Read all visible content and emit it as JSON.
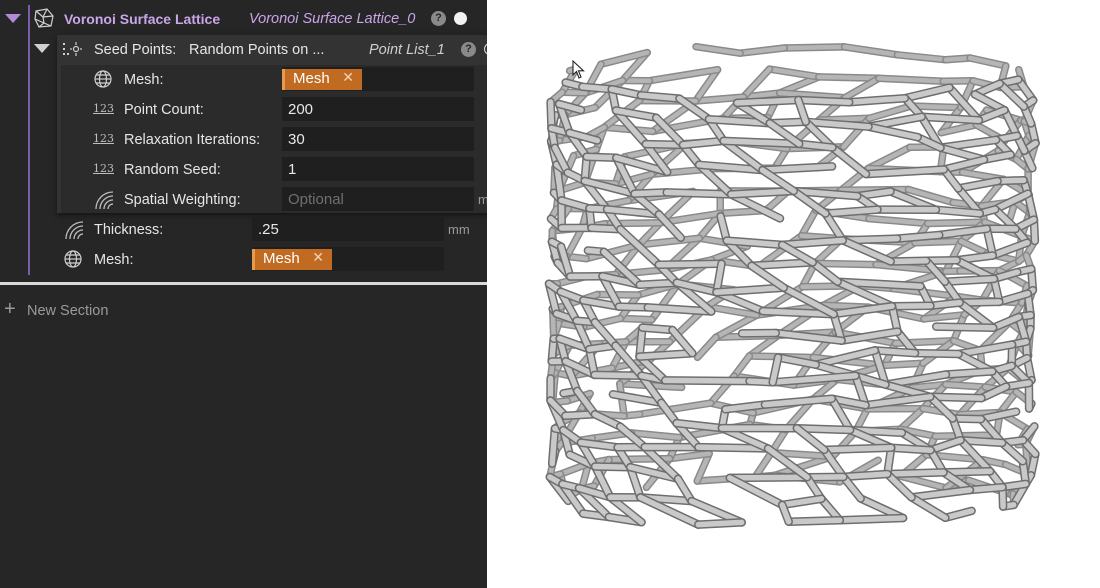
{
  "lattice": {
    "title": "Voronoi Surface Lattice",
    "instance": "Voronoi Surface Lattice_0",
    "help": "?"
  },
  "seed": {
    "label": "Seed Points:",
    "value": "Random Points on ...",
    "instance": "Point List_1",
    "help": "?",
    "mesh_label": "Mesh:",
    "mesh_chip": "Mesh",
    "point_count_label": "Point Count:",
    "point_count": "200",
    "relax_label": "Relaxation Iterations:",
    "relax": "30",
    "random_seed_label": "Random Seed:",
    "random_seed": "1",
    "spatial_label": "Spatial Weighting:",
    "spatial_placeholder": "Optional",
    "spatial_unit": "mm"
  },
  "thickness": {
    "label": "Thickness:",
    "value": ".25",
    "unit": "mm"
  },
  "mesh": {
    "label": "Mesh:",
    "chip": "Mesh"
  },
  "new_section": "New Section",
  "icons": {
    "num": "123",
    "x": "✕",
    "plus": "+"
  },
  "colors": {
    "panel": "#262626",
    "chip": "#c06a22",
    "accent": "#b48ad8"
  }
}
